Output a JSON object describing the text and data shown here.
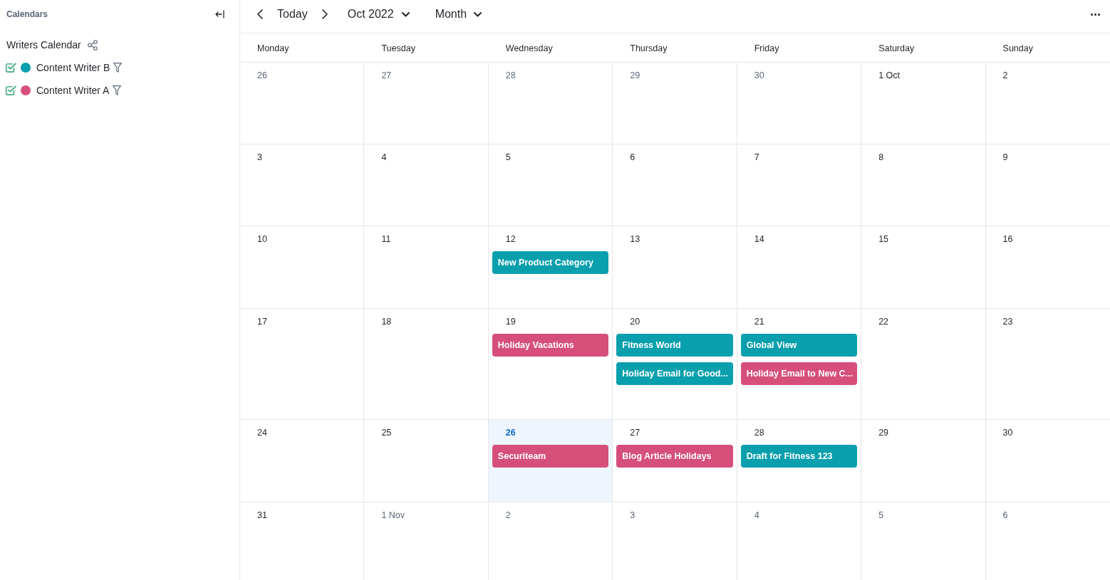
{
  "sidebar": {
    "title": "Calendars",
    "group_name": "Writers Calendar",
    "calendars": [
      {
        "name": "Content Writer B",
        "checked": true,
        "color": "#0a9fad"
      },
      {
        "name": "Content Writer A",
        "checked": true,
        "color": "#d64f7b"
      }
    ]
  },
  "toolbar": {
    "today_label": "Today",
    "period": "Oct 2022",
    "view": "Month"
  },
  "weekdays": [
    "Monday",
    "Tuesday",
    "Wednesday",
    "Thursday",
    "Friday",
    "Saturday",
    "Sunday"
  ],
  "weeks": [
    {
      "days": [
        {
          "label": "26",
          "in_month": false,
          "today": false
        },
        {
          "label": "27",
          "in_month": false,
          "today": false
        },
        {
          "label": "28",
          "in_month": false,
          "today": false
        },
        {
          "label": "29",
          "in_month": false,
          "today": false
        },
        {
          "label": "30",
          "in_month": false,
          "today": false
        },
        {
          "label": "1 Oct",
          "in_month": true,
          "today": false
        },
        {
          "label": "2",
          "in_month": true,
          "today": false
        }
      ]
    },
    {
      "days": [
        {
          "label": "3",
          "in_month": true,
          "today": false
        },
        {
          "label": "4",
          "in_month": true,
          "today": false
        },
        {
          "label": "5",
          "in_month": true,
          "today": false
        },
        {
          "label": "6",
          "in_month": true,
          "today": false
        },
        {
          "label": "7",
          "in_month": true,
          "today": false
        },
        {
          "label": "8",
          "in_month": true,
          "today": false
        },
        {
          "label": "9",
          "in_month": true,
          "today": false
        }
      ]
    },
    {
      "days": [
        {
          "label": "10",
          "in_month": true,
          "today": false
        },
        {
          "label": "11",
          "in_month": true,
          "today": false
        },
        {
          "label": "12",
          "in_month": true,
          "today": false,
          "events": [
            {
              "title": "New Product Category",
              "color": "#0a9fad"
            }
          ]
        },
        {
          "label": "13",
          "in_month": true,
          "today": false
        },
        {
          "label": "14",
          "in_month": true,
          "today": false
        },
        {
          "label": "15",
          "in_month": true,
          "today": false
        },
        {
          "label": "16",
          "in_month": true,
          "today": false
        }
      ]
    },
    {
      "days": [
        {
          "label": "17",
          "in_month": true,
          "today": false
        },
        {
          "label": "18",
          "in_month": true,
          "today": false
        },
        {
          "label": "19",
          "in_month": true,
          "today": false,
          "events": [
            {
              "title": "Holiday Vacations",
              "color": "#d64f7b"
            }
          ]
        },
        {
          "label": "20",
          "in_month": true,
          "today": false,
          "events": [
            {
              "title": "Fitness World",
              "color": "#0a9fad"
            },
            {
              "title": "Holiday Email for Good...",
              "color": "#0a9fad"
            }
          ]
        },
        {
          "label": "21",
          "in_month": true,
          "today": false,
          "events": [
            {
              "title": "Global View",
              "color": "#0a9fad"
            },
            {
              "title": "Holiday Email to New C...",
              "color": "#d64f7b"
            }
          ]
        },
        {
          "label": "22",
          "in_month": true,
          "today": false
        },
        {
          "label": "23",
          "in_month": true,
          "today": false
        }
      ]
    },
    {
      "days": [
        {
          "label": "24",
          "in_month": true,
          "today": false
        },
        {
          "label": "25",
          "in_month": true,
          "today": false
        },
        {
          "label": "26",
          "in_month": true,
          "today": true,
          "events": [
            {
              "title": "Securiteam",
              "color": "#d64f7b"
            }
          ]
        },
        {
          "label": "27",
          "in_month": true,
          "today": false,
          "events": [
            {
              "title": "Blog Article Holidays",
              "color": "#d64f7b"
            }
          ]
        },
        {
          "label": "28",
          "in_month": true,
          "today": false,
          "events": [
            {
              "title": "Draft for Fitness 123",
              "color": "#0a9fad"
            }
          ]
        },
        {
          "label": "29",
          "in_month": true,
          "today": false
        },
        {
          "label": "30",
          "in_month": true,
          "today": false
        }
      ]
    },
    {
      "days": [
        {
          "label": "31",
          "in_month": true,
          "today": false
        },
        {
          "label": "1 Nov",
          "in_month": false,
          "today": false
        },
        {
          "label": "2",
          "in_month": false,
          "today": false
        },
        {
          "label": "3",
          "in_month": false,
          "today": false
        },
        {
          "label": "4",
          "in_month": false,
          "today": false
        },
        {
          "label": "5",
          "in_month": false,
          "today": false
        },
        {
          "label": "6",
          "in_month": false,
          "today": false
        }
      ]
    }
  ]
}
